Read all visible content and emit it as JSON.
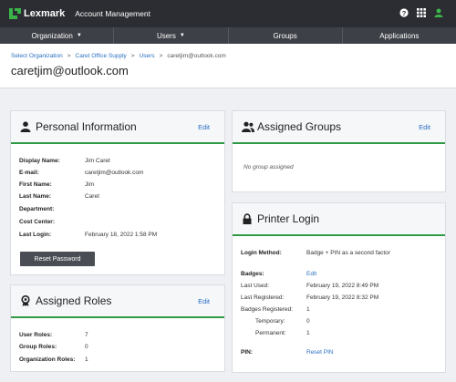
{
  "topbar": {
    "brand": "Lexmark",
    "app_title": "Account Management",
    "icons": [
      "help-icon",
      "apps-grid-icon",
      "user-icon"
    ]
  },
  "nav": {
    "items": [
      {
        "label": "Organization",
        "dropdown": true
      },
      {
        "label": "Users",
        "dropdown": true
      },
      {
        "label": "Groups",
        "dropdown": false
      },
      {
        "label": "Applications",
        "dropdown": false
      }
    ]
  },
  "breadcrumb": {
    "items": [
      "Select Organization",
      "Caret Office Supply",
      "Users",
      "caretjim@outlook.com"
    ],
    "separator": ">"
  },
  "page_title": "caretjim@outlook.com",
  "personal": {
    "title": "Personal Information",
    "edit": "Edit",
    "fields": [
      {
        "label": "Display Name:",
        "value": "Jim Caret"
      },
      {
        "label": "E-mail:",
        "value": "caretjim@outlook.com"
      },
      {
        "label": "First Name:",
        "value": "Jim"
      },
      {
        "label": "Last Name:",
        "value": "Caret"
      },
      {
        "label": "Department:",
        "value": ""
      },
      {
        "label": "Cost Center:",
        "value": ""
      },
      {
        "label": "Last Login:",
        "value": "February 18, 2022 1:58 PM"
      }
    ],
    "reset_button": "Reset Password"
  },
  "roles": {
    "title": "Assigned Roles",
    "edit": "Edit",
    "fields": [
      {
        "label": "User Roles:",
        "value": "7"
      },
      {
        "label": "Group Roles:",
        "value": "0"
      },
      {
        "label": "Organization Roles:",
        "value": "1"
      }
    ]
  },
  "groups": {
    "title": "Assigned Groups",
    "edit": "Edit",
    "empty": "No group assigned"
  },
  "printer": {
    "title": "Printer Login",
    "login_method_label": "Login Method:",
    "login_method_value": "Badge + PIN as a second factor",
    "badges_label": "Badges:",
    "badges_edit": "Edit",
    "last_used_label": "Last Used:",
    "last_used_value": "February 19, 2022 8:49 PM",
    "last_registered_label": "Last Registered:",
    "last_registered_value": "February 19, 2022 8:32 PM",
    "badges_registered_label": "Badges Registered:",
    "badges_registered_value": "1",
    "temporary_label": "Temporary:",
    "temporary_value": "0",
    "permanent_label": "Permanent:",
    "permanent_value": "1",
    "pin_label": "PIN:",
    "pin_action": "Reset PIN"
  },
  "colors": {
    "topbar": "#2b2d32",
    "navbar": "#3d4046",
    "accent_green": "#2e9a45",
    "link_blue": "#2a6fc0",
    "brand_green": "#3bb54a"
  }
}
